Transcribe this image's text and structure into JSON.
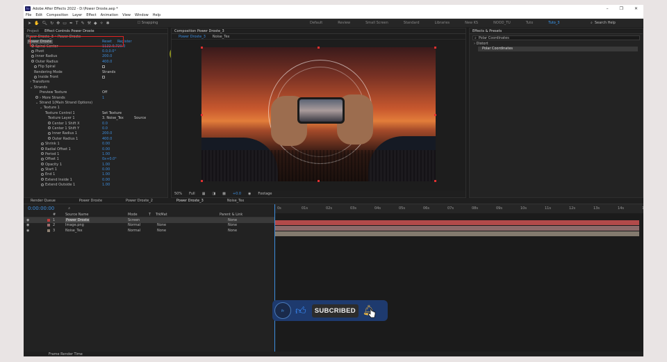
{
  "window": {
    "title": "Adobe After Effects 2022 - D:\\Power Droste.aep *",
    "controls": [
      "–",
      "❐",
      "✕"
    ]
  },
  "menu": [
    "File",
    "Edit",
    "Composition",
    "Layer",
    "Effect",
    "Animation",
    "View",
    "Window",
    "Help"
  ],
  "toolbar": {
    "snapping": "Snapping",
    "workspaces": [
      "Default",
      "Review",
      "Small Screen",
      "Standard",
      "Libraries",
      "New KS",
      "NOOD_TU",
      "Tuto",
      "Tuto_3"
    ],
    "active_workspace": "Tuto_3",
    "search_help": "Search Help"
  },
  "project_panel": {
    "tabs": [
      "Project",
      "Effect Controls Power Droste"
    ],
    "subtitle": "Power Droste_3 • Power Droste",
    "effect_name": "Power Droste",
    "reset": "Reset",
    "register": "Register",
    "properties": [
      {
        "name": "Spiral Center",
        "value": "1122.0,720.0",
        "indent": 10,
        "type": "value"
      },
      {
        "name": "Pivot",
        "value": "0.0,0.0°",
        "indent": 10,
        "type": "value"
      },
      {
        "name": "Inner Radius",
        "value": "200.0",
        "indent": 10,
        "type": "value"
      },
      {
        "name": "Outer Radius",
        "value": "400.0",
        "indent": 10,
        "type": "value"
      },
      {
        "name": "Flip Spiral",
        "value": "",
        "indent": 14,
        "type": "check"
      },
      {
        "name": "Rendering Mode",
        "value": "Strands",
        "indent": 14,
        "type": "text"
      },
      {
        "name": "Inside Front",
        "value": "",
        "indent": 14,
        "type": "check"
      },
      {
        "name": "› Transform",
        "value": "",
        "indent": 8,
        "type": "plain"
      },
      {
        "name": "⌄ Strands",
        "value": "",
        "indent": 8,
        "type": "plain"
      },
      {
        "name": "Preview Texture",
        "value": "Off",
        "indent": 22,
        "type": "text"
      },
      {
        "name": "› More Strands",
        "value": "1",
        "indent": 16,
        "type": "value"
      },
      {
        "name": "⌄ Strand 1(Main Strand Options)",
        "value": "",
        "indent": 16,
        "type": "plain"
      },
      {
        "name": "⌄ Texture 1",
        "value": "",
        "indent": 22,
        "type": "plain"
      },
      {
        "name": "Texture Control 1",
        "value": "Set Texture",
        "indent": 30,
        "type": "text"
      },
      {
        "name": "Texture Layer 1",
        "value": "3. Noise_Tex",
        "indent": 34,
        "type": "text"
      },
      {
        "name": "Center 1 Shift X",
        "value": "0.0",
        "indent": 34,
        "type": "value"
      },
      {
        "name": "Center 1 Shift Y",
        "value": "0.0",
        "indent": 34,
        "type": "value"
      },
      {
        "name": "Inner Radius 1",
        "value": "200.0",
        "indent": 34,
        "type": "value"
      },
      {
        "name": "Outer Radius 1",
        "value": "400.0",
        "indent": 34,
        "type": "value"
      },
      {
        "name": "Shrink 1",
        "value": "0.00",
        "indent": 24,
        "type": "value"
      },
      {
        "name": "Radial Offset 1",
        "value": "0.00",
        "indent": 24,
        "type": "value"
      },
      {
        "name": "Period 1",
        "value": "1.00",
        "indent": 24,
        "type": "value"
      },
      {
        "name": "Offset 1",
        "value": "0x+0.0°",
        "indent": 24,
        "type": "value"
      },
      {
        "name": "Opacity 1",
        "value": "1.00",
        "indent": 24,
        "type": "value"
      },
      {
        "name": "Start 1",
        "value": "0.00",
        "indent": 24,
        "type": "value"
      },
      {
        "name": "End 1",
        "value": "1.00",
        "indent": 24,
        "type": "value"
      },
      {
        "name": "Extend Inside 1",
        "value": "0.00",
        "indent": 24,
        "type": "value"
      },
      {
        "name": "Extend Outside 1",
        "value": "1.00",
        "indent": 24,
        "type": "value"
      }
    ],
    "source_label": "Source"
  },
  "composition_panel": {
    "tabs": [
      "Composition Power Droste_3",
      "Power Droste_3",
      "Noise_Tex"
    ],
    "zoom": "50%",
    "resolution": "Full",
    "time": "0:00:00:00",
    "exposure": "+0.0",
    "info": "Footage"
  },
  "effects_panel": {
    "title": "Effects & Presets",
    "search": "Polar Coordinates",
    "category": "› Distort",
    "result": "Polar Coordinates"
  },
  "timeline": {
    "tabs": [
      "Render Queue",
      "Power Droste",
      "Power Droste_2",
      "Power Droste_3",
      "Noise_Tex"
    ],
    "active_tab": "Power Droste_3",
    "timecode": "0:00:00:00",
    "columns": [
      "#",
      "Source Name",
      "Mode",
      "T",
      "TrkMat",
      "Parent & Link"
    ],
    "layers": [
      {
        "num": "1",
        "name": "Power Droste",
        "mode": "Screen",
        "trkmat": "",
        "parent": "None",
        "color": "#c43a3a",
        "selected": true
      },
      {
        "num": "2",
        "name": "Image.png",
        "mode": "Normal",
        "trkmat": "None",
        "parent": "None",
        "color": "#9b6e6e",
        "selected": false
      },
      {
        "num": "3",
        "name": "Noise_Tex",
        "mode": "Normal",
        "trkmat": "None",
        "parent": "None",
        "color": "#8e8172",
        "selected": false
      }
    ],
    "ruler": [
      "0s",
      "01s",
      "02s",
      "03s",
      "04s",
      "05s",
      "06s",
      "07s",
      "08s",
      "09s",
      "10s",
      "11s",
      "12s",
      "13s",
      "14s",
      "15s"
    ],
    "footer": "Frame Render Time"
  },
  "overlay": {
    "subscribed_label": "SUBCRIBED",
    "logo_text": "Pr"
  }
}
